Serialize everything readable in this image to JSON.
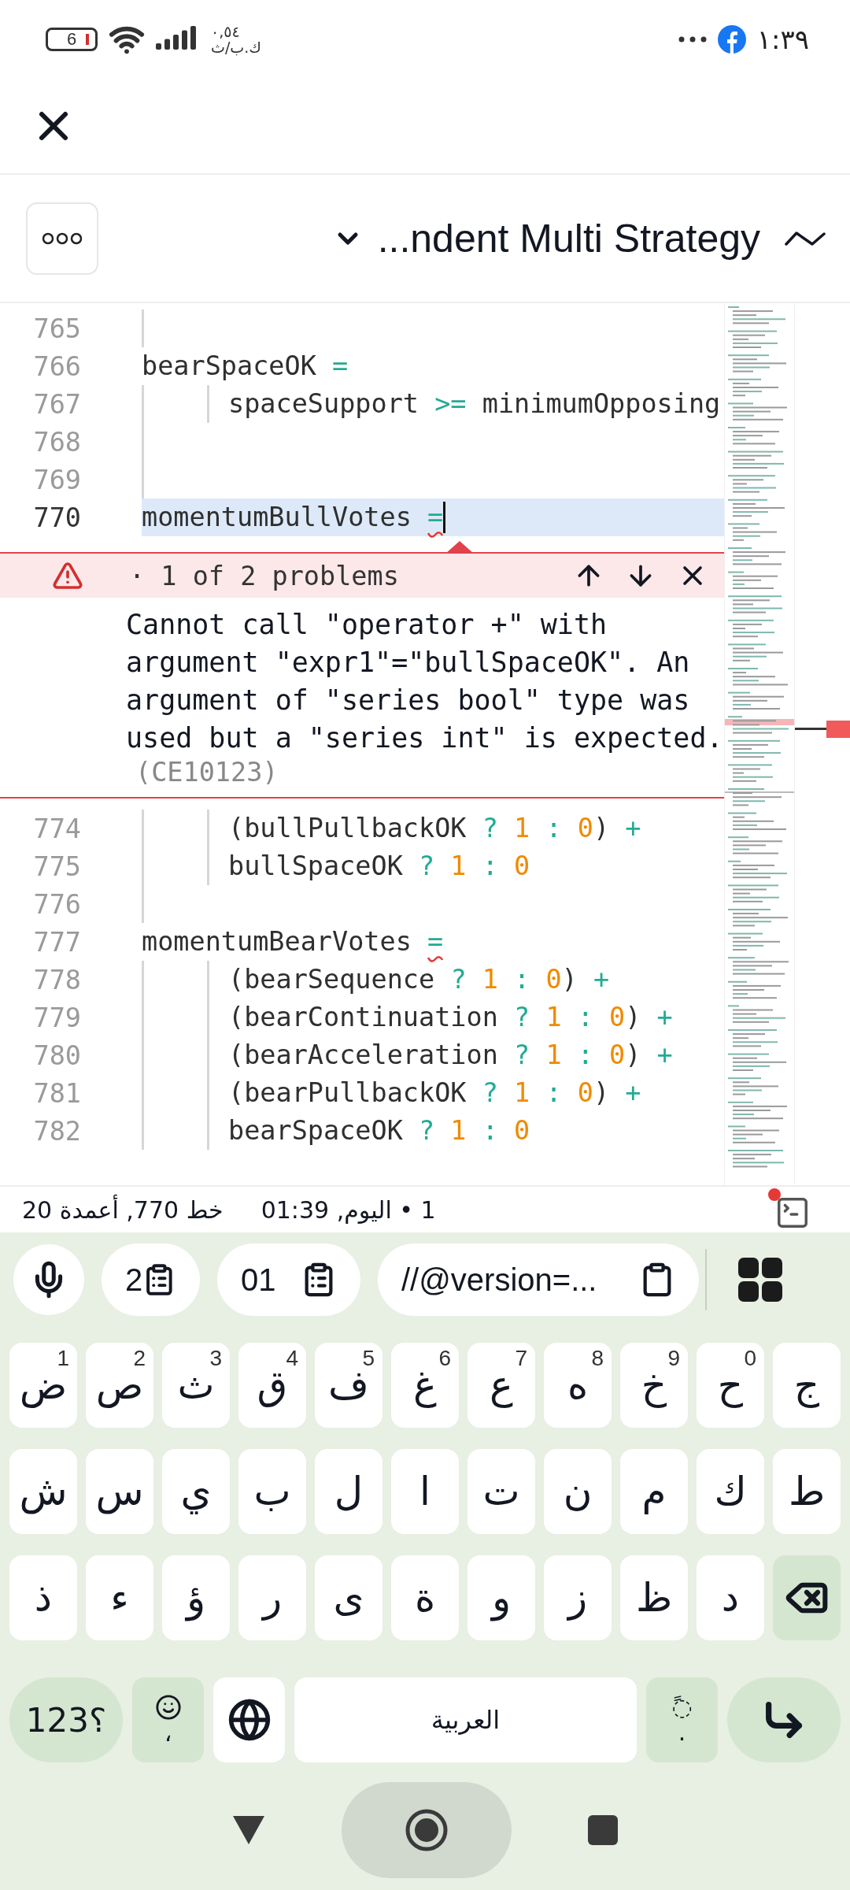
{
  "status_bar": {
    "battery": "6",
    "speed_value": "٠,٥٤",
    "speed_unit": "ك.ب/ث",
    "time": "١:٣٩"
  },
  "header": {
    "title": "...ndent Multi Strategy"
  },
  "editor": {
    "lines_above": [
      {
        "number": "765",
        "kind": "blank",
        "selected": false
      },
      {
        "number": "766",
        "kind": "statement",
        "selected": false,
        "tokens": [
          {
            "text": "bearSpaceOK ",
            "kind": "id"
          },
          {
            "text": "=",
            "kind": "op"
          }
        ]
      },
      {
        "number": "767",
        "kind": "nested",
        "selected": false,
        "tokens": [
          {
            "text": "spaceSupport ",
            "kind": "id"
          },
          {
            "text": ">=",
            "kind": "op"
          },
          {
            "text": " minimumOpposing",
            "kind": "id"
          }
        ]
      },
      {
        "number": "768",
        "kind": "blank",
        "selected": false
      },
      {
        "number": "769",
        "kind": "blank",
        "selected": false
      },
      {
        "number": "770",
        "kind": "statement",
        "selected": true,
        "tokens": [
          {
            "text": "momentumBullVotes ",
            "kind": "id"
          },
          {
            "text": "=",
            "kind": "op",
            "error": true
          }
        ]
      }
    ],
    "problem": {
      "counter": "· 1 of 2 problems",
      "message": "Cannot call \"operator +\" with argument \"expr1\"=\"bullSpaceOK\". An argument of \"series bool\" type was used but a \"series int\" is expected.",
      "code": "(CE10123)"
    },
    "lines_below": [
      {
        "number": "774",
        "kind": "nested",
        "selected": false,
        "tokens": [
          {
            "text": "(bullPullbackOK ",
            "kind": "id"
          },
          {
            "text": "?",
            "kind": "op"
          },
          {
            "text": " 1 ",
            "kind": "num"
          },
          {
            "text": ":",
            "kind": "op"
          },
          {
            "text": " 0",
            "kind": "num"
          },
          {
            "text": ") ",
            "kind": "id"
          },
          {
            "text": "+",
            "kind": "op"
          }
        ]
      },
      {
        "number": "775",
        "kind": "nested",
        "selected": false,
        "tokens": [
          {
            "text": "bullSpaceOK ",
            "kind": "id"
          },
          {
            "text": "?",
            "kind": "op"
          },
          {
            "text": " 1 ",
            "kind": "num"
          },
          {
            "text": ":",
            "kind": "op"
          },
          {
            "text": " 0",
            "kind": "num"
          }
        ]
      },
      {
        "number": "776",
        "kind": "blank",
        "selected": false
      },
      {
        "number": "777",
        "kind": "statement",
        "selected": false,
        "tokens": [
          {
            "text": "momentumBearVotes ",
            "kind": "id"
          },
          {
            "text": "=",
            "kind": "op",
            "error": true
          }
        ]
      },
      {
        "number": "778",
        "kind": "nested",
        "selected": false,
        "tokens": [
          {
            "text": "(bearSequence ",
            "kind": "id"
          },
          {
            "text": "?",
            "kind": "op"
          },
          {
            "text": " 1 ",
            "kind": "num"
          },
          {
            "text": ":",
            "kind": "op"
          },
          {
            "text": " 0",
            "kind": "num"
          },
          {
            "text": ") ",
            "kind": "id"
          },
          {
            "text": "+",
            "kind": "op"
          }
        ]
      },
      {
        "number": "779",
        "kind": "nested",
        "selected": false,
        "tokens": [
          {
            "text": "(bearContinuation ",
            "kind": "id"
          },
          {
            "text": "?",
            "kind": "op"
          },
          {
            "text": " 1 ",
            "kind": "num"
          },
          {
            "text": ":",
            "kind": "op"
          },
          {
            "text": " 0",
            "kind": "num"
          },
          {
            "text": ") ",
            "kind": "id"
          },
          {
            "text": "+",
            "kind": "op"
          }
        ]
      },
      {
        "number": "780",
        "kind": "nested",
        "selected": false,
        "tokens": [
          {
            "text": "(bearAcceleration ",
            "kind": "id"
          },
          {
            "text": "?",
            "kind": "op"
          },
          {
            "text": " 1 ",
            "kind": "num"
          },
          {
            "text": ":",
            "kind": "op"
          },
          {
            "text": " 0",
            "kind": "num"
          },
          {
            "text": ") ",
            "kind": "id"
          },
          {
            "text": "+",
            "kind": "op"
          }
        ]
      },
      {
        "number": "781",
        "kind": "nested",
        "selected": false,
        "tokens": [
          {
            "text": "(bearPullbackOK ",
            "kind": "id"
          },
          {
            "text": "?",
            "kind": "op"
          },
          {
            "text": " 1 ",
            "kind": "num"
          },
          {
            "text": ":",
            "kind": "op"
          },
          {
            "text": " 0",
            "kind": "num"
          },
          {
            "text": ") ",
            "kind": "id"
          },
          {
            "text": "+",
            "kind": "op"
          }
        ]
      },
      {
        "number": "782",
        "kind": "nested",
        "selected": false,
        "tokens": [
          {
            "text": "bearSpaceOK ",
            "kind": "id"
          },
          {
            "text": "?",
            "kind": "op"
          },
          {
            "text": " 1 ",
            "kind": "num"
          },
          {
            "text": ":",
            "kind": "op"
          },
          {
            "text": " 0",
            "kind": "num"
          }
        ]
      }
    ]
  },
  "editor_status": {
    "position": "خط 770, أعمدة 20",
    "changes": "1 • اليوم, 01:39"
  },
  "keyboard": {
    "suggestions": [
      {
        "kind": "clip-number",
        "text": "2"
      },
      {
        "kind": "clip-number",
        "text": "01"
      },
      {
        "kind": "clip-text",
        "text": "//@version=..."
      }
    ],
    "rows": [
      [
        {
          "kind": "char",
          "char": "ض",
          "hint": "1"
        },
        {
          "kind": "char",
          "char": "ص",
          "hint": "2"
        },
        {
          "kind": "char",
          "char": "ث",
          "hint": "3"
        },
        {
          "kind": "char",
          "char": "ق",
          "hint": "4"
        },
        {
          "kind": "char",
          "char": "ف",
          "hint": "5"
        },
        {
          "kind": "char",
          "char": "غ",
          "hint": "6"
        },
        {
          "kind": "char",
          "char": "ع",
          "hint": "7"
        },
        {
          "kind": "char",
          "char": "ه",
          "hint": "8"
        },
        {
          "kind": "char",
          "char": "خ",
          "hint": "9"
        },
        {
          "kind": "char",
          "char": "ح",
          "hint": "0"
        },
        {
          "kind": "char",
          "char": "ج"
        }
      ],
      [
        {
          "kind": "char",
          "char": "ش"
        },
        {
          "kind": "char",
          "char": "س"
        },
        {
          "kind": "char",
          "char": "ي"
        },
        {
          "kind": "char",
          "char": "ب"
        },
        {
          "kind": "char",
          "char": "ل"
        },
        {
          "kind": "char",
          "char": "ا"
        },
        {
          "kind": "char",
          "char": "ت"
        },
        {
          "kind": "char",
          "char": "ن"
        },
        {
          "kind": "char",
          "char": "م"
        },
        {
          "kind": "char",
          "char": "ك"
        },
        {
          "kind": "char",
          "char": "ط"
        }
      ],
      [
        {
          "kind": "char",
          "char": "ذ"
        },
        {
          "kind": "char",
          "char": "ء"
        },
        {
          "kind": "char",
          "char": "ؤ"
        },
        {
          "kind": "char",
          "char": "ر"
        },
        {
          "kind": "char",
          "char": "ى"
        },
        {
          "kind": "char",
          "char": "ة"
        },
        {
          "kind": "char",
          "char": "و"
        },
        {
          "kind": "char",
          "char": "ز"
        },
        {
          "kind": "char",
          "char": "ظ"
        },
        {
          "kind": "char",
          "char": "د"
        },
        {
          "kind": "backspace"
        }
      ]
    ],
    "bottom_row": {
      "symbols_key": "؟123",
      "emoji_key": "،",
      "space_key": "العربية",
      "diacritic_key": {
        "top": "◌ً",
        "bottom": "."
      }
    }
  }
}
